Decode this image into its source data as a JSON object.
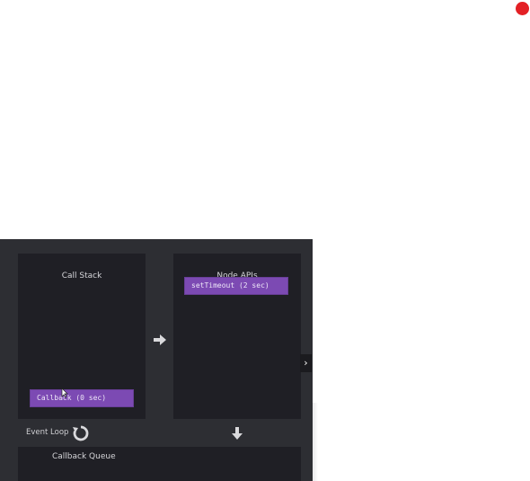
{
  "recording_indicator": {
    "color": "#e32025"
  },
  "panels": {
    "call_stack": {
      "title": "Call Stack",
      "items": [
        "Callback (0 sec)"
      ]
    },
    "node_apis": {
      "title": "Node APIs",
      "items": [
        "setTimeout (2 sec)"
      ]
    },
    "callback_queue": {
      "title": "Callback Queue",
      "items": []
    }
  },
  "event_loop": {
    "label": "Event Loop"
  },
  "icons": {
    "flow_right": "arrow-right-icon",
    "flow_down": "arrow-down-icon",
    "loop": "refresh-loop-icon",
    "next": "chevron-right-icon"
  },
  "controls": {
    "next_label": "›"
  },
  "colors": {
    "slide_background": "#2d2e33",
    "panel_background": "#1f1f25",
    "chip_purple": "#7c4ab3",
    "text_light": "#d6d6da",
    "record_red": "#e32025"
  }
}
